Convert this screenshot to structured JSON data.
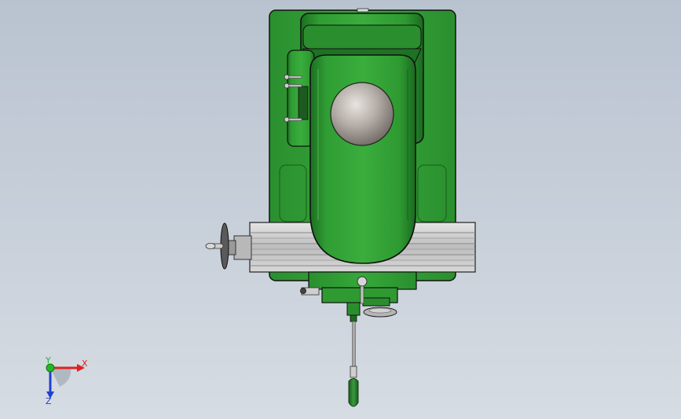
{
  "view": {
    "background_top": "#b9c3d0",
    "background_bottom": "#d6dce3",
    "model_color": "#2f9a33",
    "model_dark": "#1f6d22",
    "steel_color": "#c9c9c9"
  },
  "triad": {
    "x_label": "X",
    "y_label": "Y",
    "z_label": "Z",
    "x_color": "#e02020",
    "y_color": "#22b822",
    "z_color": "#2040d0"
  },
  "model": {
    "parts": [
      "column",
      "head",
      "ram",
      "spindle-dome",
      "worktable",
      "table-handwheel",
      "knee",
      "feed-handle",
      "adjust-screws"
    ]
  }
}
